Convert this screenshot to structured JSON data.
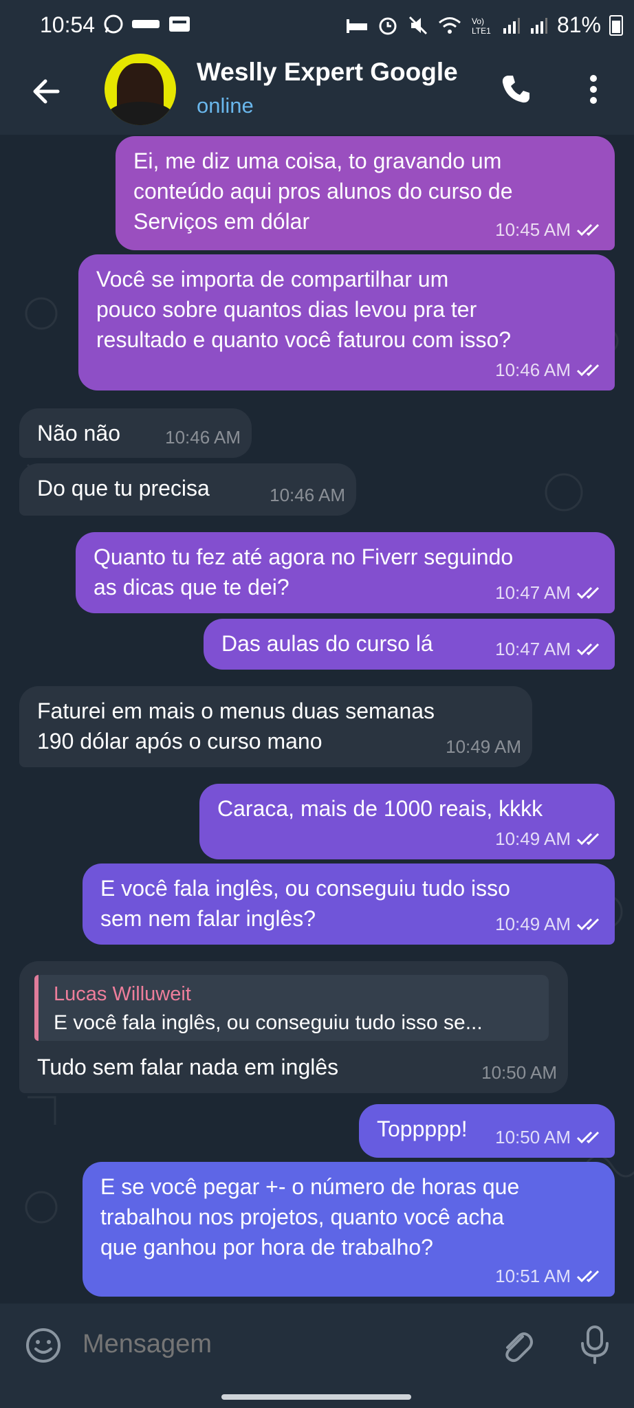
{
  "status_bar": {
    "time": "10:54",
    "left_icons": [
      "whatsapp-icon",
      "ifood-icon",
      "notification-icon"
    ],
    "right_icons": [
      "bed-icon",
      "alarm-icon",
      "mute-icon",
      "wifi-icon",
      "volte-icon",
      "signal-icon",
      "signal-icon"
    ],
    "battery": "81%"
  },
  "header": {
    "contact_name": "Weslly Expert Google",
    "status": "online"
  },
  "messages": [
    {
      "dir": "out",
      "lines": [
        "Ei, me diz uma coisa, to gravando um",
        "conteúdo aqui pros alunos do curso de",
        "Serviços em dólar"
      ],
      "time": "10:45 AM"
    },
    {
      "dir": "out",
      "lines": [
        "Você se importa de compartilhar um",
        "pouco sobre quantos dias levou pra ter",
        "resultado e quanto você faturou com isso?"
      ],
      "time": "10:46 AM"
    },
    {
      "dir": "in",
      "lines": [
        "Não não"
      ],
      "time": "10:46 AM"
    },
    {
      "dir": "in",
      "lines": [
        "Do que tu precisa"
      ],
      "time": "10:46 AM"
    },
    {
      "dir": "out",
      "lines": [
        "Quanto tu fez até agora no Fiverr seguindo",
        "as dicas que te dei?"
      ],
      "time": "10:47 AM"
    },
    {
      "dir": "out",
      "lines": [
        "Das aulas do curso lá"
      ],
      "time": "10:47 AM"
    },
    {
      "dir": "in",
      "lines": [
        "Faturei em mais o menus duas semanas",
        "190 dólar após o curso mano"
      ],
      "time": "10:49 AM"
    },
    {
      "dir": "out",
      "lines": [
        "Caraca, mais de 1000 reais, kkkk"
      ],
      "time": "10:49 AM"
    },
    {
      "dir": "out",
      "lines": [
        "E você fala inglês, ou conseguiu tudo isso",
        "sem nem falar inglês?"
      ],
      "time": "10:49 AM"
    },
    {
      "dir": "in",
      "reply_author": "Lucas Willuweit",
      "reply_text": "E você fala inglês, ou conseguiu tudo isso se...",
      "lines": [
        "Tudo sem falar nada em inglês"
      ],
      "time": "10:50 AM"
    },
    {
      "dir": "out",
      "lines": [
        "Toppppp!"
      ],
      "time": "10:50 AM"
    },
    {
      "dir": "out",
      "lines": [
        "E se você pegar +- o número de horas que",
        "trabalhou nos projetos, quanto você acha",
        "que ganhou por hora de trabalho?"
      ],
      "time": "10:51 AM"
    }
  ],
  "input": {
    "placeholder": "Mensagem"
  },
  "colors": {
    "bubble_out_top": "#9a4fbf",
    "bubble_out_bottom": "#5b6ae6",
    "bubble_in": "#2a3440",
    "status_online": "#6ab7ec",
    "reply_author": "#ee7e9b"
  }
}
